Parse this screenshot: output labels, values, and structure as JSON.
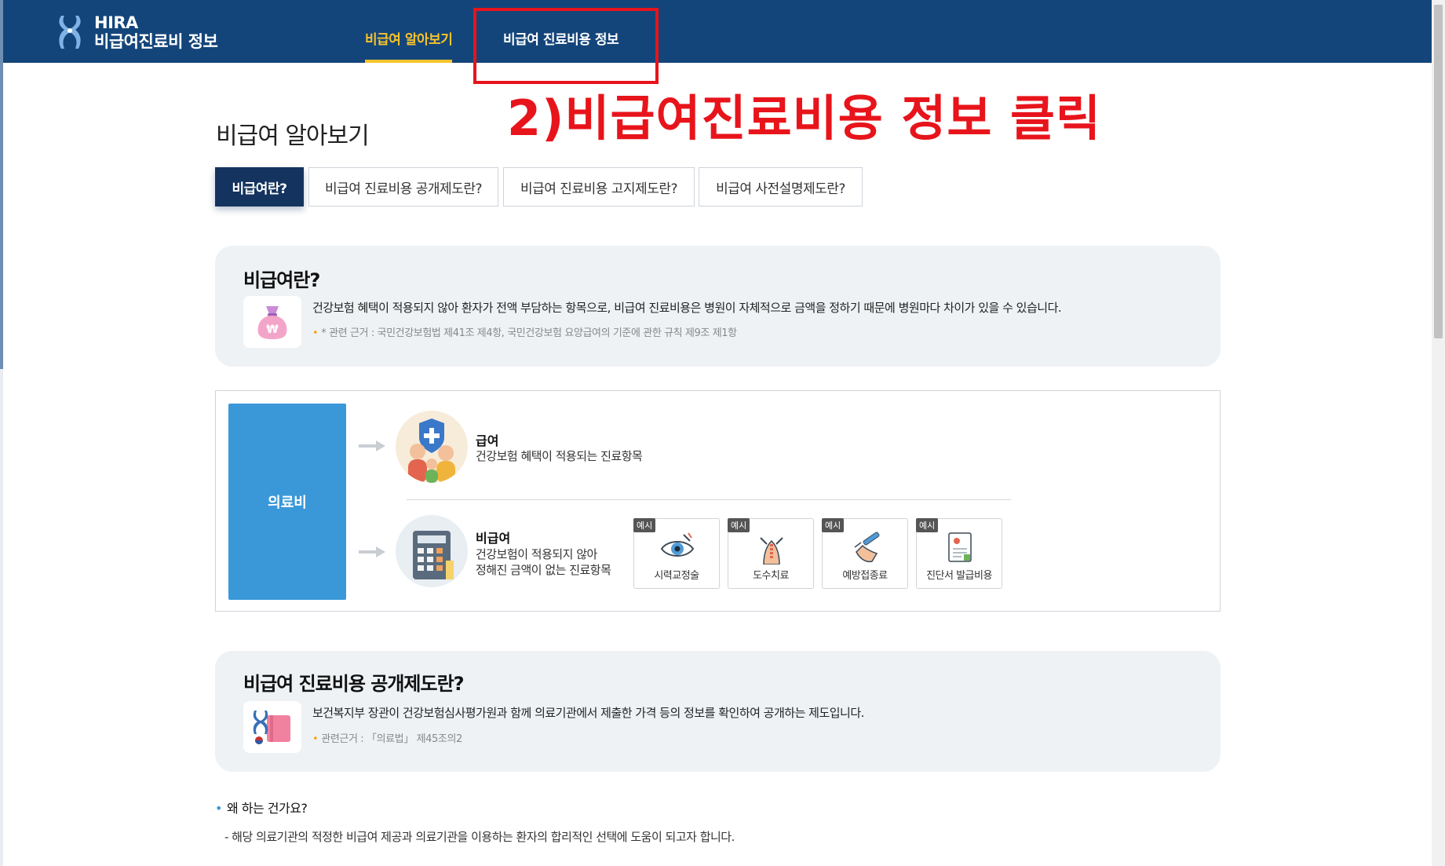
{
  "header": {
    "logo_brand": "HIRA",
    "logo_subtitle": "비급여진료비 정보",
    "nav": [
      {
        "label": "비급여 알아보기",
        "active": true
      },
      {
        "label": "비급여 진료비용 정보",
        "active": false
      }
    ]
  },
  "annotation": {
    "text": "2)비급여진료비용 정보 클릭",
    "color": "#e8141b"
  },
  "page": {
    "title": "비급여 알아보기",
    "subtabs": [
      {
        "label": "비급여란?",
        "active": true
      },
      {
        "label": "비급여 진료비용 공개제도란?",
        "active": false
      },
      {
        "label": "비급여 진료비용 고지제도란?",
        "active": false
      },
      {
        "label": "비급여 사전설명제도란?",
        "active": false
      }
    ]
  },
  "card_nonbenefit": {
    "title": "비급여란?",
    "icon": "money-bag-icon",
    "description": "건강보험 혜택이 적용되지 않아 환자가 전액 부담하는 항목으로, 비급여 진료비용은 병원이 자체적으로 금액을 정하기 때문에 병원마다 차이가 있을 수 있습니다.",
    "reference": "* 관련 근거 : 국민건강보험법 제41조 제4항, 국민건강보험 요양급여의 기준에 관한 규칙 제9조 제1항"
  },
  "diagram": {
    "medical_fee": "의료비",
    "benefit": {
      "title": "급여",
      "description": "건강보험 혜택이 적용되는 진료항목"
    },
    "nonbenefit": {
      "title": "비급여",
      "description_line1": "건강보험이 적용되지 않아",
      "description_line2": "정해진 금액이 없는 진료항목"
    },
    "examples": [
      {
        "badge": "예시",
        "label": "시력교정술",
        "icon": "eye-icon"
      },
      {
        "badge": "예시",
        "label": "도수치료",
        "icon": "spine-icon"
      },
      {
        "badge": "예시",
        "label": "예방접종료",
        "icon": "syringe-icon"
      },
      {
        "badge": "예시",
        "label": "진단서 발급비용",
        "icon": "certificate-icon"
      }
    ]
  },
  "card_disclosure": {
    "title": "비급여 진료비용 공개제도란?",
    "icon": "ministry-book-icon",
    "description": "보건복지부 장관이 건강보험심사평가원과 함께 의료기관에서 제출한 가격 등의 정보를 확인하여 공개하는 제도입니다.",
    "reference": "관련근거 : 「의료법」 제45조의2"
  },
  "why": {
    "question": "왜 하는 건가요?",
    "answer": "- 해당 의료기관의 적정한 비급여 제공과 의료기관을 이용하는 환자의 합리적인 선택에 도움이 되고자 합니다."
  }
}
